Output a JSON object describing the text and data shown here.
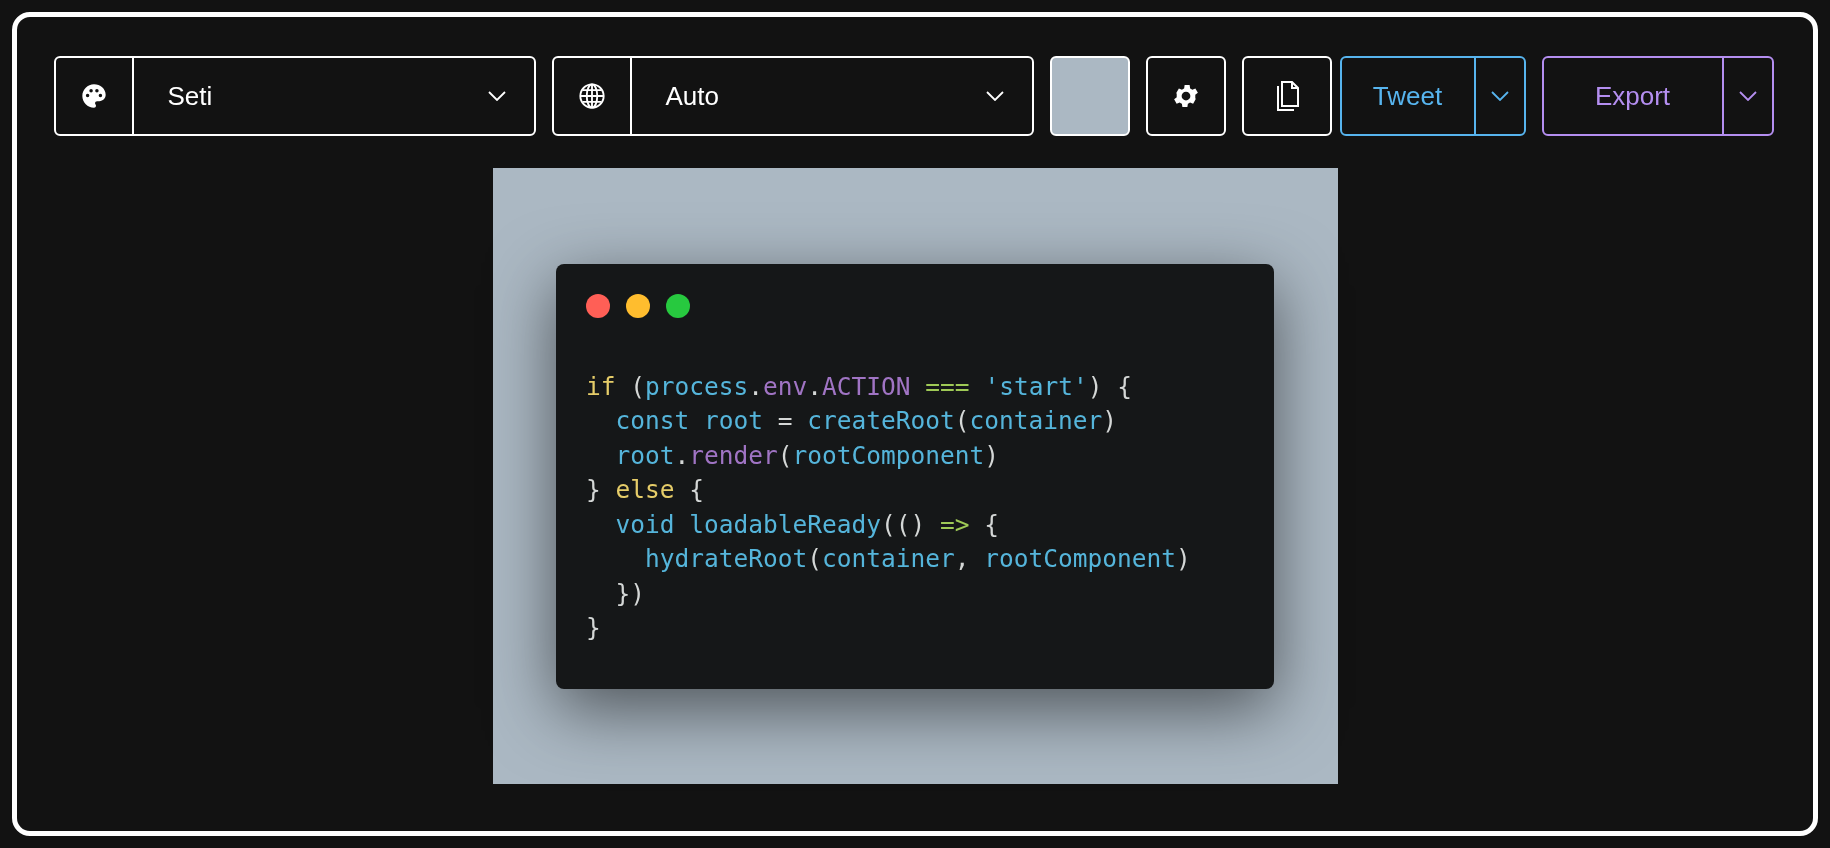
{
  "toolbar": {
    "theme": {
      "value": "Seti"
    },
    "language": {
      "value": "Auto"
    },
    "background_swatch": {
      "color": "#abb8c3"
    },
    "tweet": {
      "label": "Tweet"
    },
    "export": {
      "label": "Export"
    }
  },
  "code_window": {
    "lines": [
      [
        {
          "text": "if",
          "kind": "keyword"
        },
        {
          "text": " (",
          "kind": "punct"
        },
        {
          "text": "process",
          "kind": "ident"
        },
        {
          "text": ".",
          "kind": "punct"
        },
        {
          "text": "env",
          "kind": "prop"
        },
        {
          "text": ".",
          "kind": "punct"
        },
        {
          "text": "ACTION ",
          "kind": "prop"
        },
        {
          "text": "===",
          "kind": "op"
        },
        {
          "text": " 'start'",
          "kind": "ident"
        },
        {
          "text": ") {",
          "kind": "punct"
        }
      ],
      [
        {
          "text": "  const root",
          "kind": "ident"
        },
        {
          "text": " = ",
          "kind": "punct"
        },
        {
          "text": "createRoot",
          "kind": "ident"
        },
        {
          "text": "(",
          "kind": "punct"
        },
        {
          "text": "container",
          "kind": "ident"
        },
        {
          "text": ")",
          "kind": "punct"
        }
      ],
      [
        {
          "text": "  root",
          "kind": "ident"
        },
        {
          "text": ".",
          "kind": "punct"
        },
        {
          "text": "render",
          "kind": "prop"
        },
        {
          "text": "(",
          "kind": "punct"
        },
        {
          "text": "rootComponent",
          "kind": "ident"
        },
        {
          "text": ")",
          "kind": "punct"
        }
      ],
      [
        {
          "text": "} ",
          "kind": "punct"
        },
        {
          "text": "else",
          "kind": "keyword"
        },
        {
          "text": " {",
          "kind": "punct"
        }
      ],
      [
        {
          "text": "  void loadableReady",
          "kind": "ident"
        },
        {
          "text": "(() ",
          "kind": "punct"
        },
        {
          "text": "=>",
          "kind": "op"
        },
        {
          "text": " {",
          "kind": "punct"
        }
      ],
      [
        {
          "text": "    hydrateRoot",
          "kind": "ident"
        },
        {
          "text": "(",
          "kind": "punct"
        },
        {
          "text": "container",
          "kind": "ident"
        },
        {
          "text": ", ",
          "kind": "punct"
        },
        {
          "text": "rootComponent",
          "kind": "ident"
        },
        {
          "text": ")",
          "kind": "punct"
        }
      ],
      [
        {
          "text": "  })",
          "kind": "punct"
        }
      ],
      [
        {
          "text": "}",
          "kind": "punct"
        }
      ]
    ]
  }
}
